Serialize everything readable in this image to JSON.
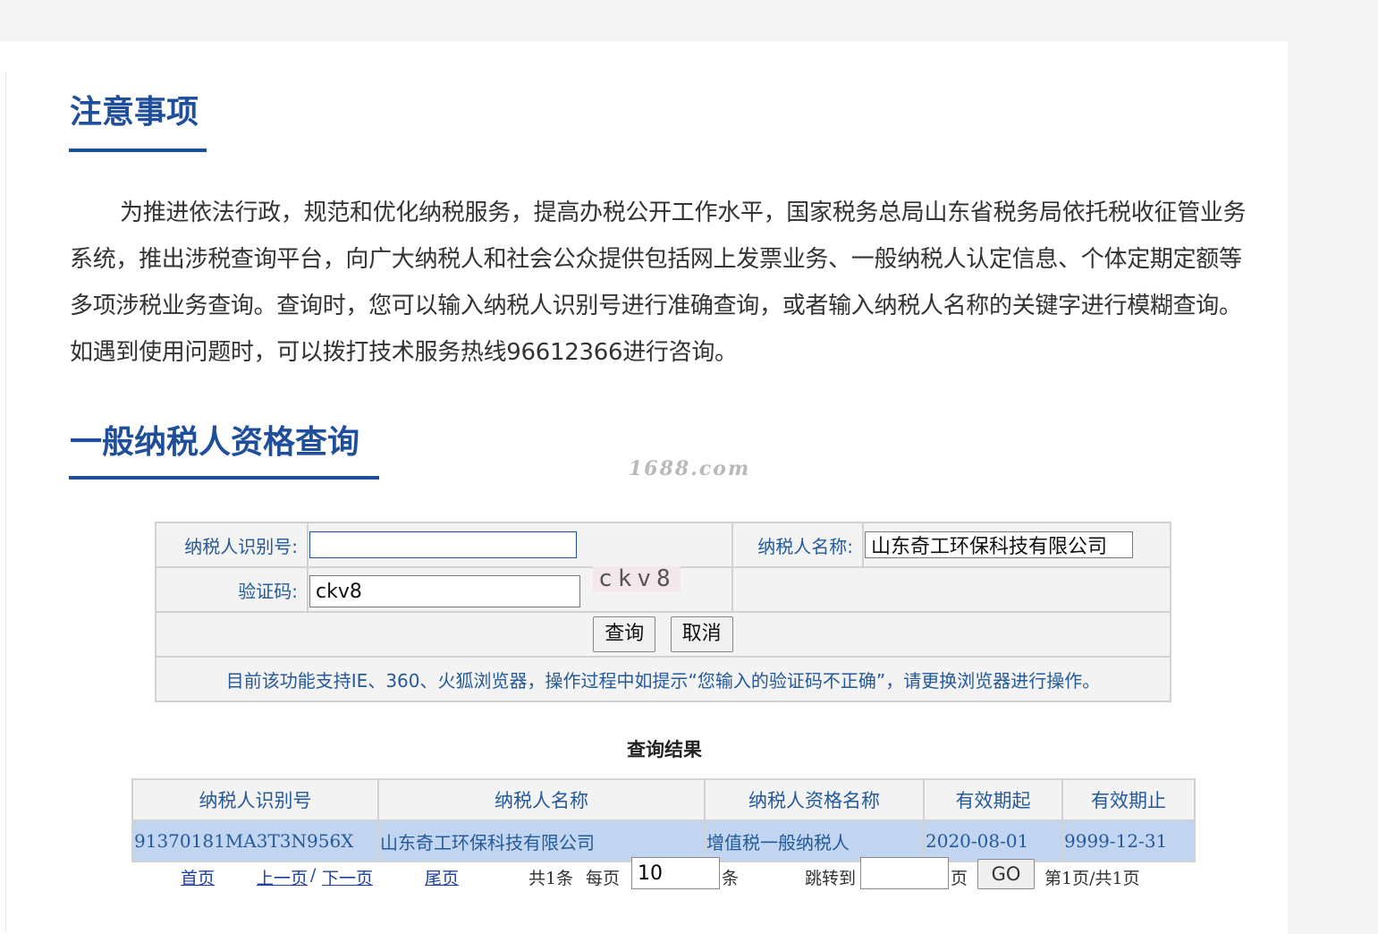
{
  "notice": {
    "title": "注意事项",
    "body": "为推进依法行政，规范和优化纳税服务，提高办税公开工作水平，国家税务总局山东省税务局依托税收征管业务系统，推出涉税查询平台，向广大纳税人和社会公众提供包括网上发票业务、一般纳税人认定信息、个体定期定额等多项涉税业务查询。查询时，您可以输入纳税人识别号进行准确查询，或者输入纳税人名称的关键字进行模糊查询。如遇到使用问题时，可以拨打技术服务热线96612366进行咨询。"
  },
  "query": {
    "title": "一般纳税人资格查询",
    "watermark": "1688.com",
    "taxpayer_id_label": "纳税人识别号:",
    "taxpayer_id_value": "",
    "taxpayer_name_label": "纳税人名称:",
    "taxpayer_name_value": "山东奇工环保科技有限公司",
    "captcha_label": "验证码:",
    "captcha_value": "ckv8",
    "captcha_image_text": "ckv8",
    "submit_label": "查询",
    "cancel_label": "取消",
    "hint": "目前该功能支持IE、360、火狐浏览器，操作过程中如提示“您输入的验证码不正确”，请更换浏览器进行操作。"
  },
  "results": {
    "title": "查询结果",
    "columns": [
      "纳税人识别号",
      "纳税人名称",
      "纳税人资格名称",
      "有效期起",
      "有效期止"
    ],
    "rows": [
      [
        "91370181MA3T3N956X",
        "山东奇工环保科技有限公司",
        "增值税一般纳税人",
        "2020-08-01",
        "9999-12-31"
      ]
    ]
  },
  "pager": {
    "first": "首页",
    "prev": "上一页",
    "sep": "/",
    "next": "下一页",
    "last": "尾页",
    "total": "共1条",
    "per_page_label": "每页",
    "per_page_value": "10",
    "per_page_unit": "条",
    "jump_label": "跳转到",
    "jump_value": "",
    "page_unit": "页",
    "go_label": "GO",
    "status": "第1页/共1页"
  }
}
